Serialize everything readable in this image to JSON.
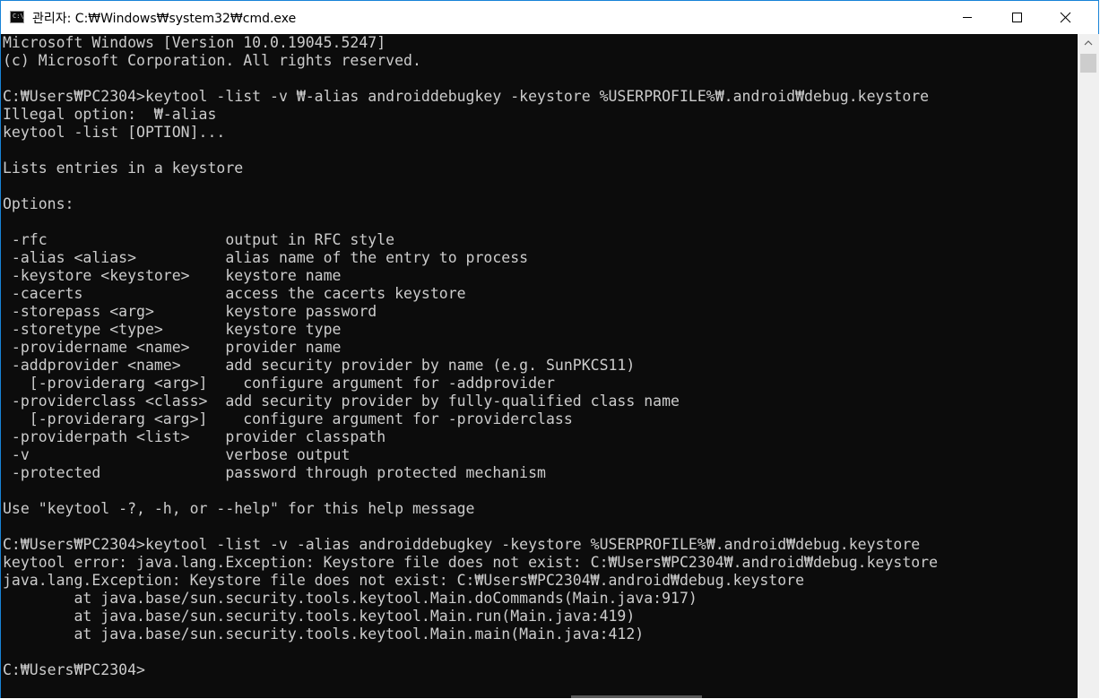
{
  "window": {
    "title": "관리자: C:₩Windows₩system32₩cmd.exe",
    "icon_label": "C:\\"
  },
  "console": {
    "lines": [
      "Microsoft Windows [Version 10.0.19045.5247]",
      "(c) Microsoft Corporation. All rights reserved.",
      "",
      "C:₩Users₩PC2304>keytool -list -v ₩-alias androiddebugkey -keystore %USERPROFILE%₩.android₩debug.keystore",
      "Illegal option:  ₩-alias",
      "keytool -list [OPTION]...",
      "",
      "Lists entries in a keystore",
      "",
      "Options:",
      "",
      " -rfc                    output in RFC style",
      " -alias <alias>          alias name of the entry to process",
      " -keystore <keystore>    keystore name",
      " -cacerts                access the cacerts keystore",
      " -storepass <arg>        keystore password",
      " -storetype <type>       keystore type",
      " -providername <name>    provider name",
      " -addprovider <name>     add security provider by name (e.g. SunPKCS11)",
      "   [-providerarg <arg>]    configure argument for -addprovider",
      " -providerclass <class>  add security provider by fully-qualified class name",
      "   [-providerarg <arg>]    configure argument for -providerclass",
      " -providerpath <list>    provider classpath",
      " -v                      verbose output",
      " -protected              password through protected mechanism",
      "",
      "Use \"keytool -?, -h, or --help\" for this help message",
      "",
      "C:₩Users₩PC2304>keytool -list -v -alias androiddebugkey -keystore %USERPROFILE%₩.android₩debug.keystore",
      "keytool error: java.lang.Exception: Keystore file does not exist: C:₩Users₩PC2304₩.android₩debug.keystore",
      "java.lang.Exception: Keystore file does not exist: C:₩Users₩PC2304₩.android₩debug.keystore",
      "        at java.base/sun.security.tools.keytool.Main.doCommands(Main.java:917)",
      "        at java.base/sun.security.tools.keytool.Main.run(Main.java:419)",
      "        at java.base/sun.security.tools.keytool.Main.main(Main.java:412)",
      "",
      "C:₩Users₩PC2304>"
    ]
  },
  "colors": {
    "console_bg": "#0c0c0c",
    "console_fg": "#cccccc",
    "window_border": "#1883d7"
  },
  "icons": {
    "minimize": "minimize-icon",
    "maximize": "maximize-icon",
    "close": "close-icon",
    "scroll_up": "chevron-up-icon"
  }
}
